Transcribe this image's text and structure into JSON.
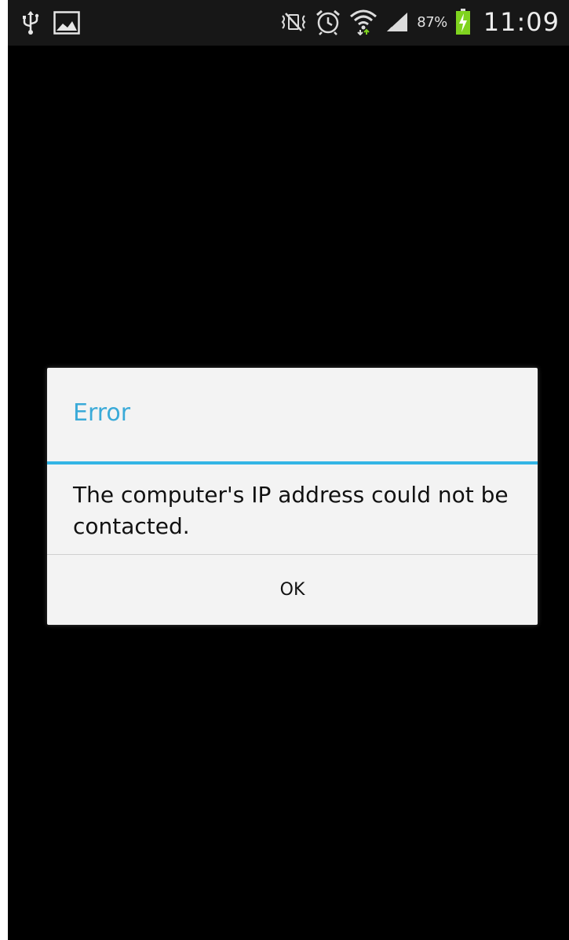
{
  "status_bar": {
    "icons_left": [
      "usb-icon",
      "image-icon"
    ],
    "icons_right": [
      "silent-mode-icon",
      "alarm-icon",
      "wifi-icon",
      "cellular-signal-icon",
      "battery-charging-icon"
    ],
    "battery_percent": "87%",
    "time": "11:09"
  },
  "dialog": {
    "title": "Error",
    "message": "The computer's IP address could not be contacted.",
    "ok_label": "OK"
  },
  "colors": {
    "accent": "#33b5e5",
    "title_text": "#3aaad8",
    "dialog_bg": "#f3f3f3",
    "screen_bg": "#000000",
    "status_bar_bg": "#171717",
    "battery_charge": "#7fd31f"
  }
}
